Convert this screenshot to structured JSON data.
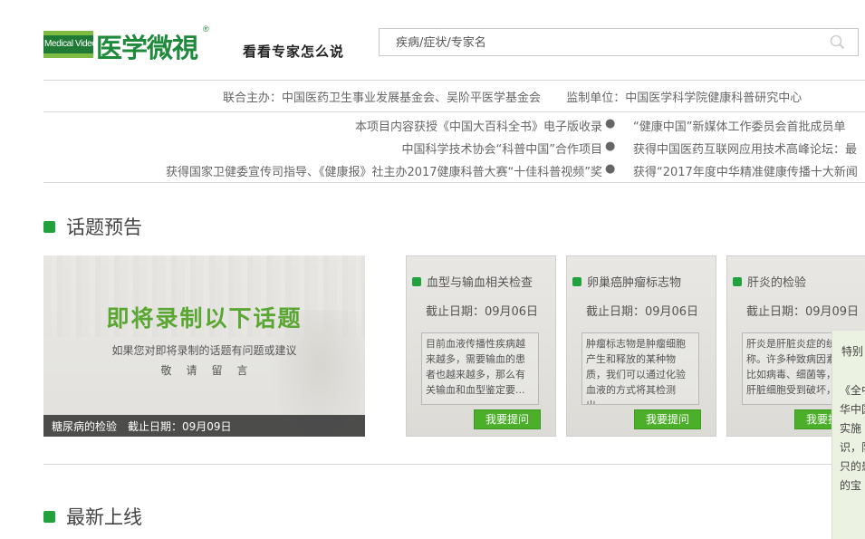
{
  "header": {
    "logo_badge": "Medical Video",
    "logo_name": "医学微視",
    "logo_reg": "®",
    "slogan": "看看专家怎么说",
    "search_placeholder": "疾病/症状/专家名"
  },
  "info": {
    "host": "联合主办：中国医药卫生事业发展基金会、吴阶平医学基金会",
    "supervisor": "监制单位：中国医学科学院健康科普研究中心"
  },
  "ticker": [
    {
      "left": "本项目内容获授《中国大百科全书》电子版收录",
      "right": "“健康中国”新媒体工作委员会首批成员单"
    },
    {
      "left": "中国科学技术协会“科普中国”合作项目",
      "right": "获得中国医药互联网应用技术高峰论坛：最"
    },
    {
      "left": "获得国家卫健委宣传司指导、《健康报》社主办2017健康科普大赛“十佳科普视频”奖",
      "right": "获得“2017年度中华精准健康传播十大新闻"
    }
  ],
  "ticker_sep": "●",
  "sections": {
    "preview_title": "话题预告",
    "latest_title": "最新上线"
  },
  "banner": {
    "title": "即将录制以下话题",
    "subtitle": "如果您对即将录制的话题有问题或建议",
    "subtitle2": "敬请留言",
    "caption": "糖尿病的检验　截止日期：09月09日"
  },
  "cards": [
    {
      "title": "血型与输血相关检查",
      "date": "截止日期：09月06日",
      "desc": "目前血液传播性疾病越来越多，需要输血的患者也越来越多，那么有关输血和血型鉴定要...",
      "button": "我要提问"
    },
    {
      "title": "卵巢癌肿瘤标志物",
      "date": "截止日期：09月06日",
      "desc": "肿瘤标志物是肿瘤细胞产生和释放的某种物质，我们可以通过化验血液的方式将其检测出...",
      "button": "我要提问"
    },
    {
      "title": "肝炎的检验",
      "date": "截止日期：09月09日",
      "desc": "肝炎是肝脏炎症的统称。许多种致病因素，比如病毒、细菌等，使肝脏细胞受到破坏，...",
      "button": "我要提问"
    }
  ],
  "notice": {
    "title": "特别",
    "body": "《全中华中国实施识，队只的患的宝"
  },
  "colors": {
    "brand_green": "#1f8a3b",
    "accent_green": "#22a23d",
    "button_green": "#4caf2a"
  }
}
